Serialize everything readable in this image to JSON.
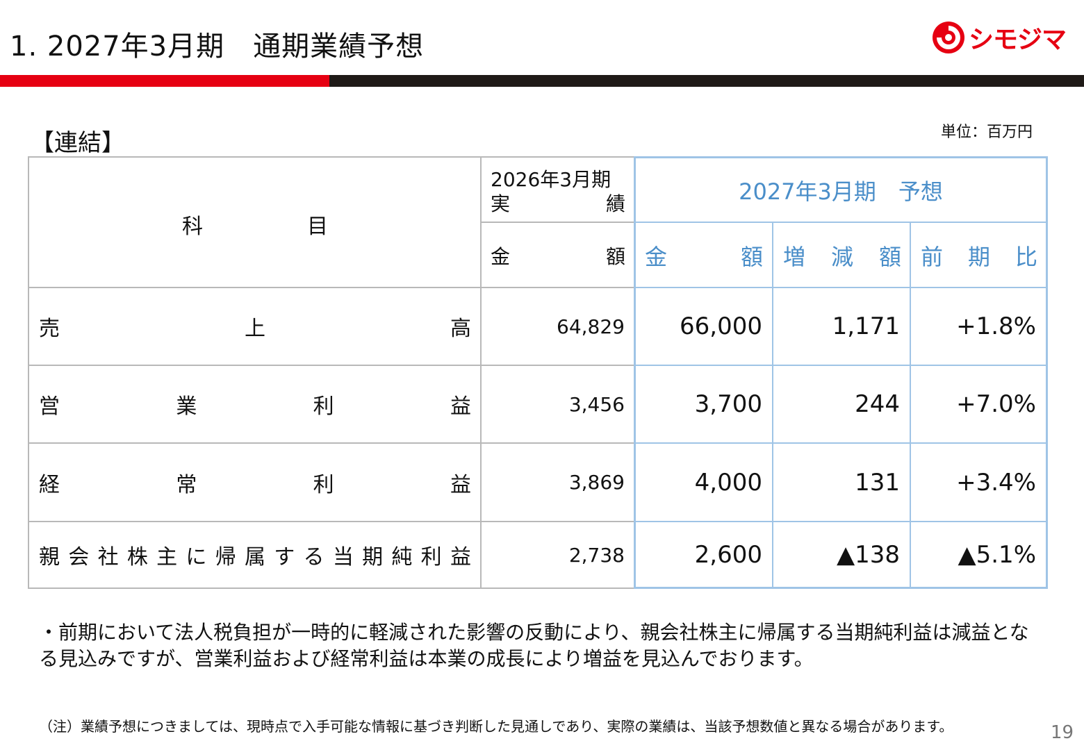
{
  "header": {
    "title": "1. 2027年3月期　通期業績予想",
    "logo_text": "シモジマ",
    "brand_color": "#e60012"
  },
  "section": {
    "label": "【連結】",
    "unit": "単位：百万円"
  },
  "table": {
    "header": {
      "subject": [
        "科",
        "目"
      ],
      "prev_period_line1": "2026年3月期",
      "prev_period_line2": [
        "実",
        "績"
      ],
      "forecast_period": "2027年3月期　予想",
      "col_amount_prev": [
        "金",
        "額"
      ],
      "col_amount_fc": [
        "金",
        "額"
      ],
      "col_change": [
        "増",
        "減",
        "額"
      ],
      "col_ratio": [
        "前",
        "期",
        "比"
      ]
    },
    "rows": [
      {
        "label": [
          "売",
          "上",
          "高"
        ],
        "prev": "64,829",
        "forecast": "66,000",
        "change": "1,171",
        "ratio": "+1.8%"
      },
      {
        "label": [
          "営",
          "業",
          "利",
          "益"
        ],
        "prev": "3,456",
        "forecast": "3,700",
        "change": "244",
        "ratio": "+7.0%"
      },
      {
        "label": [
          "経",
          "常",
          "利",
          "益"
        ],
        "prev": "3,869",
        "forecast": "4,000",
        "change": "131",
        "ratio": "+3.4%"
      },
      {
        "label": [
          "親",
          "会",
          "社",
          "株",
          "主",
          "に",
          "帰",
          "属",
          "す",
          "る",
          "当",
          "期",
          "純",
          "利",
          "益"
        ],
        "prev": "2,738",
        "forecast": "2,600",
        "change": "▲138",
        "ratio": "▲5.1%"
      }
    ],
    "forecast_color": "#4a8ec9"
  },
  "note": {
    "text": "・前期において法人税負担が一時的に軽減された影響の反動により、親会社株主に帰属する当期純利益は減益となる見込みですが、営業利益および経常利益は本業の成長により増益を見込んでおります。"
  },
  "footnote": "（注）業績予想につきましては、現時点で入手可能な情報に基づき判断した見通しであり、実際の業績は、当該予想数値と異なる場合があります。",
  "page_number": "19"
}
